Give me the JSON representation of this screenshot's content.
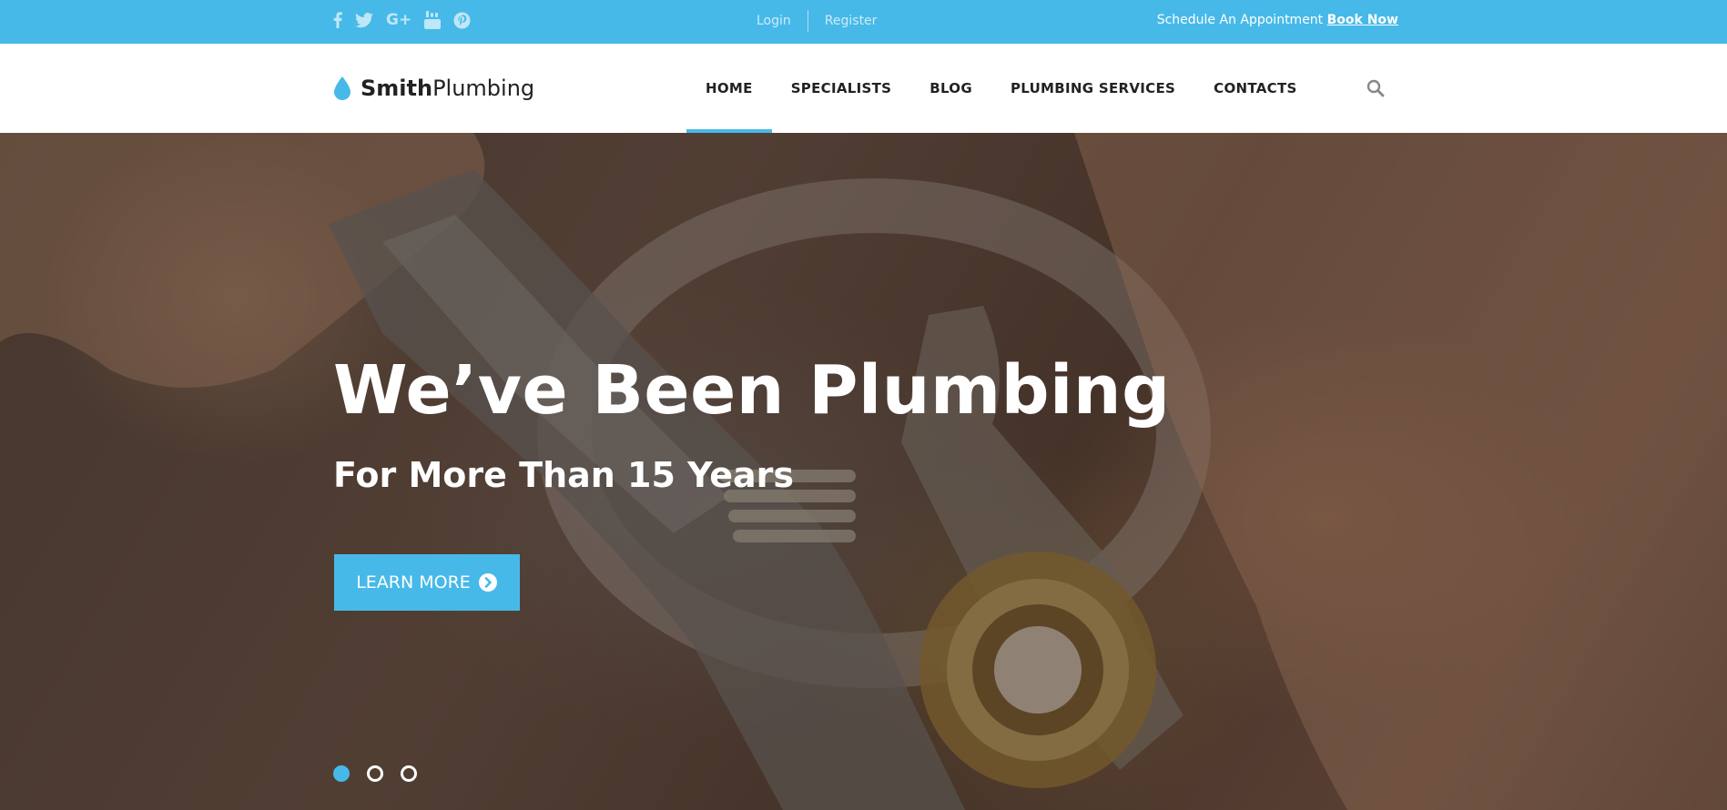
{
  "topbar": {
    "social_icons": [
      "facebook-icon",
      "twitter-icon",
      "google-plus-icon",
      "youtube-icon",
      "pinterest-icon"
    ],
    "google_plus_glyph": "G+",
    "login": "Login",
    "register": "Register",
    "appointment_text": "Schedule An Appointment",
    "book_now": "Book Now"
  },
  "header": {
    "brand_bold": "Smith",
    "brand_light": "Plumbing",
    "nav": [
      {
        "label": "HOME",
        "active": true
      },
      {
        "label": "SPECIALISTS",
        "active": false
      },
      {
        "label": "BLOG",
        "active": false
      },
      {
        "label": "PLUMBING SERVICES",
        "active": false
      },
      {
        "label": "CONTACTS",
        "active": false
      }
    ],
    "search_icon": "search-icon"
  },
  "hero": {
    "title": "We’ve Been Plumbing",
    "subtitle": "For More Than 15 Years",
    "cta_label": "LEARN MORE",
    "slides_total": 3,
    "active_slide": 1
  },
  "colors": {
    "accent": "#47b9e8",
    "text_dark": "#222222",
    "white": "#ffffff"
  }
}
